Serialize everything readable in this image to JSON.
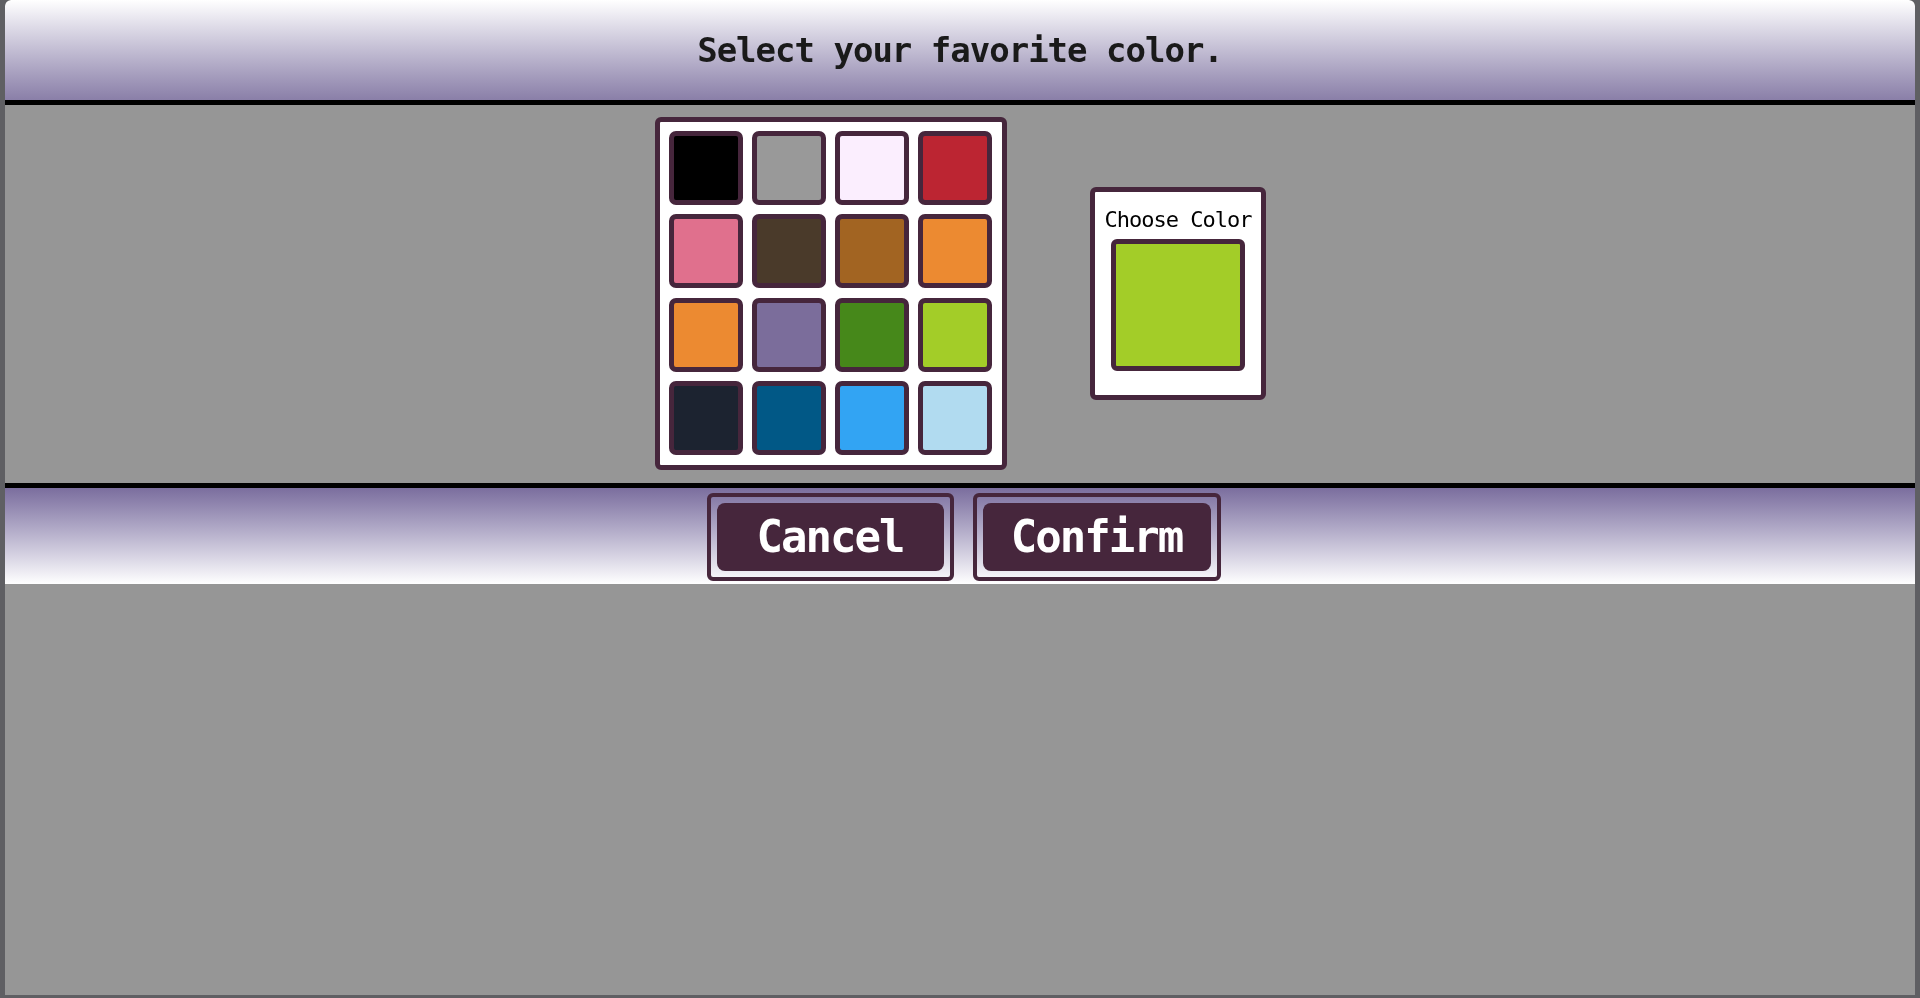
{
  "header": {
    "title": "Select your favorite color."
  },
  "palette": [
    {
      "color": "#000000"
    },
    {
      "color": "#999999"
    },
    {
      "color": "#fbeefe"
    },
    {
      "color": "#bc2532"
    },
    {
      "color": "#e0708d"
    },
    {
      "color": "#4a3a2a"
    },
    {
      "color": "#a26422"
    },
    {
      "color": "#ec8a31"
    },
    {
      "color": "#ec8a31"
    },
    {
      "color": "#7b6d9b"
    },
    {
      "color": "#46881a"
    },
    {
      "color": "#a3cd28"
    },
    {
      "color": "#1c2330"
    },
    {
      "color": "#015886"
    },
    {
      "color": "#32a4f3"
    },
    {
      "color": "#b1dbf0"
    }
  ],
  "chooser": {
    "label": "Choose Color",
    "color": "#a3cd28"
  },
  "buttons": [
    {
      "label": "Cancel"
    },
    {
      "label": "Confirm"
    }
  ]
}
